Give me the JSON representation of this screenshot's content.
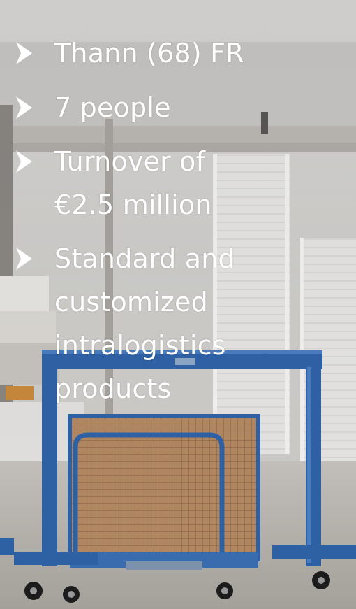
{
  "slide": {
    "bullets": [
      {
        "icon": "arrow-bullet-icon",
        "lines": [
          "Thann (68) FR"
        ]
      },
      {
        "icon": "arrow-bullet-icon",
        "lines": [
          "7 people"
        ]
      },
      {
        "icon": "arrow-bullet-icon",
        "lines": [
          "Turnover of",
          "€2.5 million"
        ]
      },
      {
        "icon": "arrow-bullet-icon",
        "lines": [
          "Standard and",
          "customized",
          "intralogistics",
          "products"
        ]
      }
    ],
    "text_color": "#ffffff",
    "accent_blue": "#2f63a8",
    "crate_color": "#b48a63"
  }
}
